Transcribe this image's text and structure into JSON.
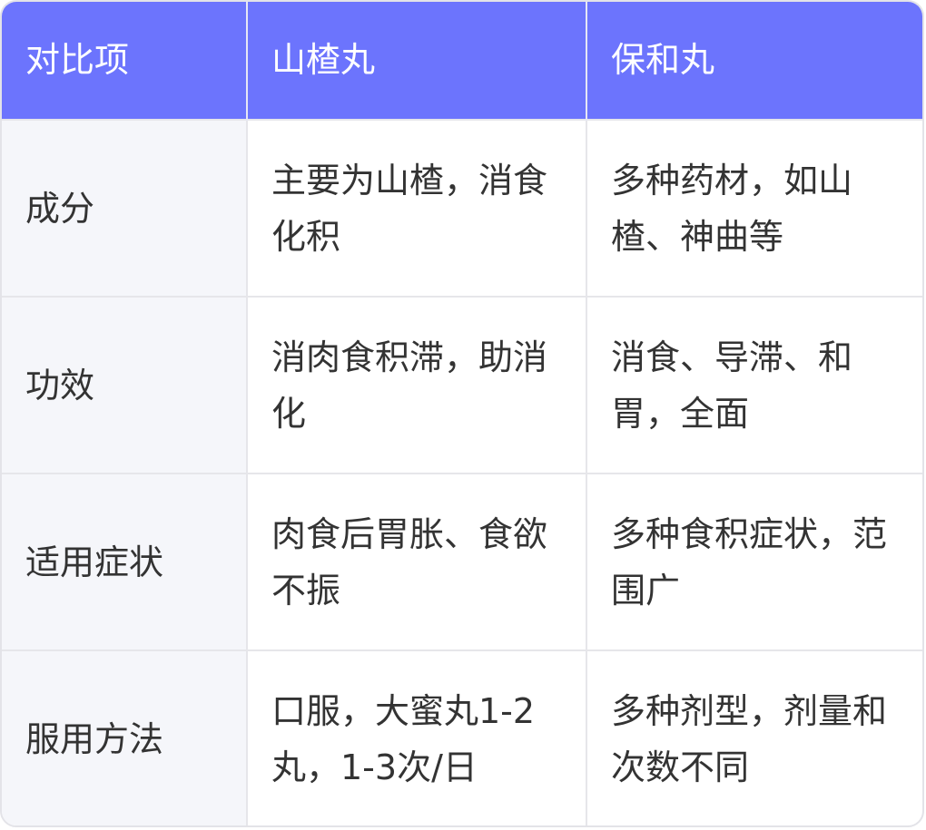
{
  "table": {
    "headers": [
      "对比项",
      "山楂丸",
      "保和丸"
    ],
    "rows": [
      {
        "item": "成分",
        "shanzha": "主要为山楂，消食化积",
        "baohe": "多种药材，如山楂、神曲等"
      },
      {
        "item": "功效",
        "shanzha": "消肉食积滞，助消化",
        "baohe": "消食、导滞、和胃，全面"
      },
      {
        "item": "适用症状",
        "shanzha": "肉食后胃胀、食欲不振",
        "baohe": "多种食积症状，范围广"
      },
      {
        "item": "服用方法",
        "shanzha": "口服，大蜜丸1-2丸，1-3次/日",
        "baohe": "多种剂型，剂量和次数不同"
      }
    ]
  },
  "colors": {
    "header_bg": "#6c74fd",
    "header_text": "#ffffff",
    "row_head_bg": "#f5f6fa",
    "border": "#e6e6ea",
    "body_text": "#333333"
  }
}
